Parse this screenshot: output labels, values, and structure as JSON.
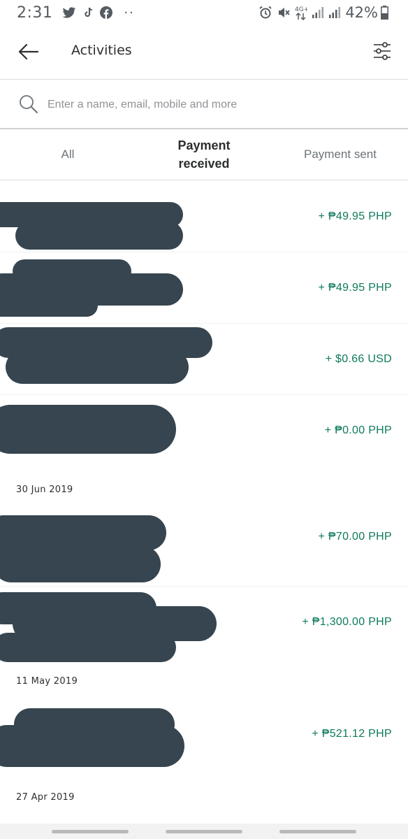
{
  "status_bar": {
    "time": "2:31",
    "left_icons": [
      "twitter-icon",
      "tiktok-icon",
      "facebook-icon"
    ],
    "more": "··",
    "right_icons": [
      "alarm-icon",
      "mute-icon",
      "network-4g-icon",
      "signal-icon",
      "signal-icon-2"
    ],
    "network": "4G+",
    "battery": "42%"
  },
  "header": {
    "title": "Activities"
  },
  "search": {
    "placeholder": "Enter a name, email, mobile and more"
  },
  "tabs": [
    {
      "label": "All",
      "active": false
    },
    {
      "label": "Payment received",
      "active": true
    },
    {
      "label": "Payment sent",
      "active": false
    }
  ],
  "transactions": {
    "group1": [
      {
        "amount": "+ ₱49.95 PHP"
      },
      {
        "amount": "+ ₱49.95 PHP"
      },
      {
        "amount": "+ $0.66 USD"
      },
      {
        "amount": "+ ₱0.00 PHP"
      }
    ],
    "date1": "30 Jun 2019",
    "group2": [
      {
        "amount": "+ ₱70.00 PHP"
      },
      {
        "amount": "+ ₱1,300.00 PHP"
      }
    ],
    "date2": "11 May 2019",
    "group3": [
      {
        "amount": "+ ₱521.12 PHP"
      }
    ],
    "date3": "27 Apr 2019"
  },
  "colors": {
    "amount_positive": "#0e7a5c",
    "redaction": "#36454f",
    "text_primary": "#2c2e2f",
    "text_secondary": "#6c7378"
  }
}
